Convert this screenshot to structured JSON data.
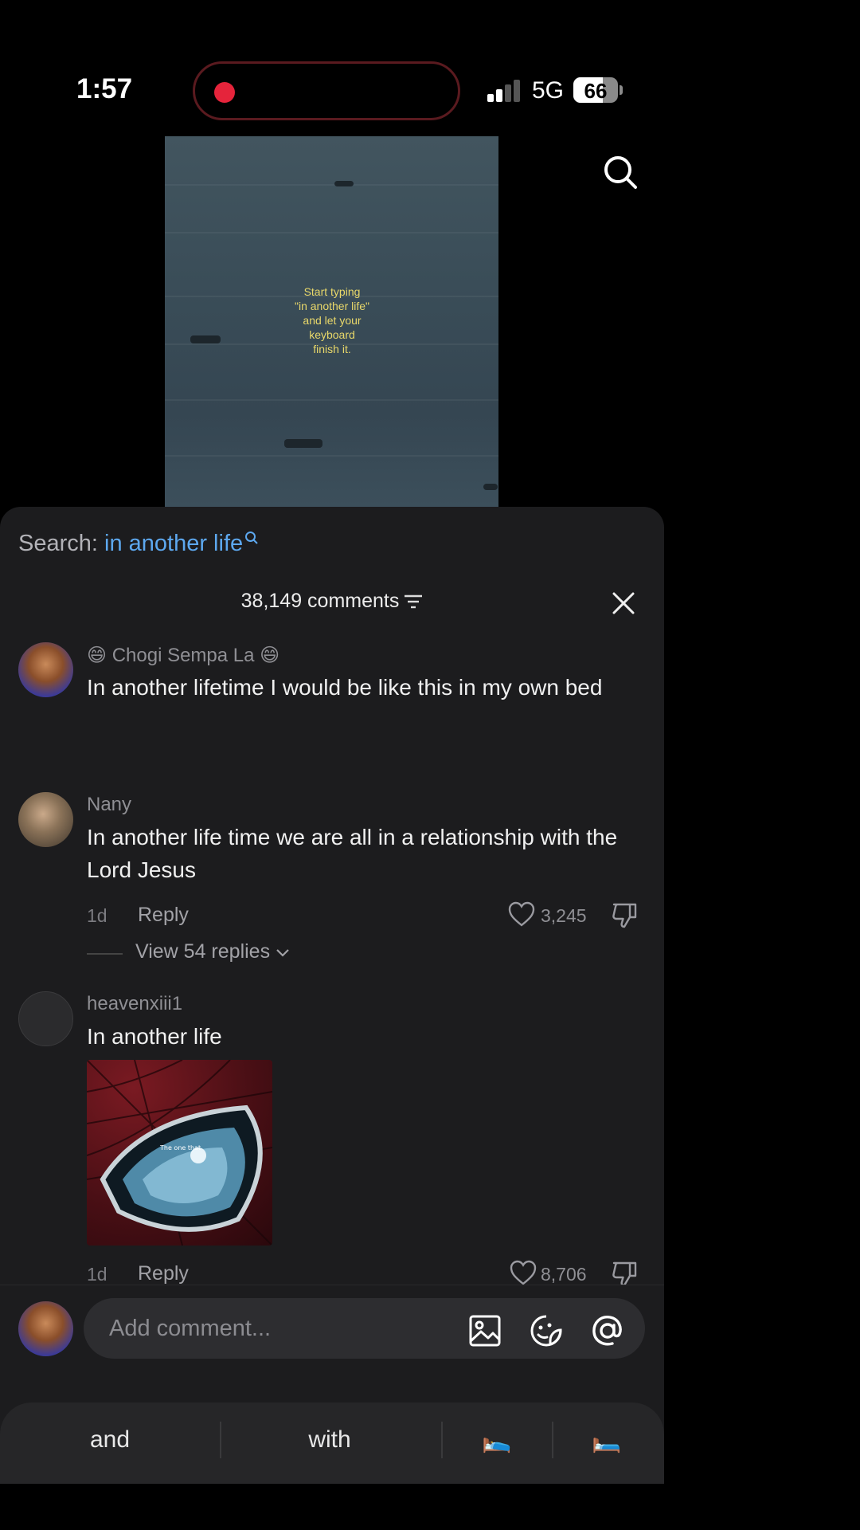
{
  "status_bar": {
    "time": "1:57",
    "network": "5G",
    "battery": "66",
    "battery_level": 0.66,
    "signal_bars": 2
  },
  "video": {
    "overlay_lines": [
      "Start typing",
      "\"in another life\"",
      "and let your",
      "keyboard",
      "finish it."
    ]
  },
  "icons": {
    "top_search": "search-icon",
    "sort": "sort-lines-icon",
    "close": "close-icon",
    "like": "heart-icon",
    "dislike": "thumbs-down-icon",
    "image": "image-icon",
    "sticker": "sticker-icon",
    "mention": "at-icon",
    "bed": "bed-emoji"
  },
  "colors": {
    "accent_link": "#5da8ef",
    "sheet_bg": "#1c1c1e",
    "overlay_text": "#e9d86a",
    "record_dot": "#e5243b"
  },
  "sheet": {
    "search_label": "Search:",
    "search_term": "in another life",
    "comments_count": "38,149 comments"
  },
  "comments": [
    {
      "user": "😄 Chogi Sempa La 😄",
      "text": "In another lifetime I would be like this in my own bed"
    },
    {
      "user": "Nany",
      "text": "In another life time we are all in a relationship with the Lord Jesus",
      "time": "1d",
      "reply": "Reply",
      "likes": "3,245",
      "view_replies": "View 54 replies"
    },
    {
      "user": "heavenxiii1",
      "text": "In another life",
      "image_caption": "The one that",
      "time": "1d",
      "reply": "Reply",
      "likes": "8,706"
    }
  ],
  "compose": {
    "placeholder": "Add comment..."
  },
  "keyboard": {
    "suggestions": [
      "and",
      "with",
      "🛌",
      "🛏️"
    ]
  }
}
